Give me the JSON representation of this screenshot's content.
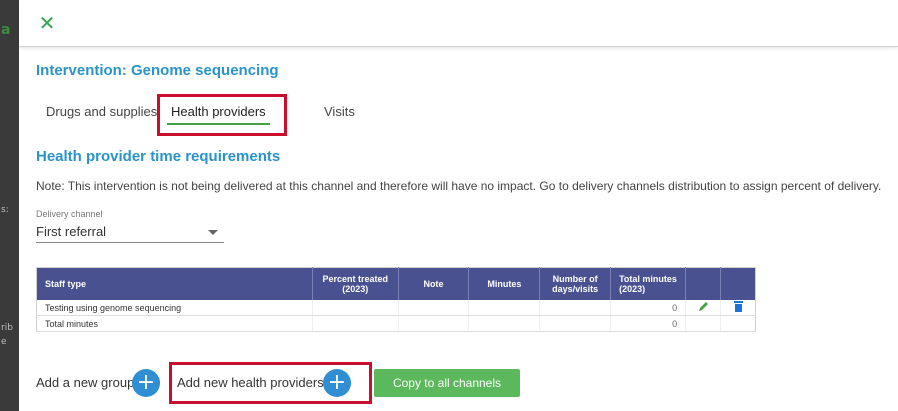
{
  "header": {
    "close_symbol": "✕"
  },
  "page": {
    "title": "Intervention: Genome sequencing"
  },
  "tabs": [
    {
      "label": "Drugs and supplies"
    },
    {
      "label": "Health providers"
    },
    {
      "label": "Visits"
    }
  ],
  "section": {
    "title": "Health provider time requirements",
    "note": "Note: This intervention is not being delivered at this channel and therefore will have no impact. Go to delivery channels distribution to assign percent of delivery."
  },
  "delivery_channel": {
    "label": "Delivery channel",
    "value": "First referral"
  },
  "table": {
    "headers": {
      "staff_type": "Staff type",
      "percent": "Percent treated (2023)",
      "note": "Note",
      "minutes": "Minutes",
      "days": "Number of days/visits",
      "total": "Total minutes (2023)"
    },
    "rows": [
      {
        "staff_type": "Testing using genome sequencing",
        "total": "0"
      },
      {
        "staff_type": "Total minutes",
        "total": "0"
      }
    ]
  },
  "actions": {
    "add_group": "Add a new group",
    "add_providers": "Add new health providers",
    "copy": "Copy to all channels",
    "plus_symbol": "+"
  },
  "colors": {
    "accent_blue": "#2a93c9",
    "header_purple": "#4a5190",
    "green": "#5cb85c",
    "highlight_red": "#c8102e"
  },
  "icons": {
    "edit": "pencil-icon",
    "delete": "trash-icon",
    "close": "close-icon",
    "dropdown": "caret-down-icon"
  }
}
